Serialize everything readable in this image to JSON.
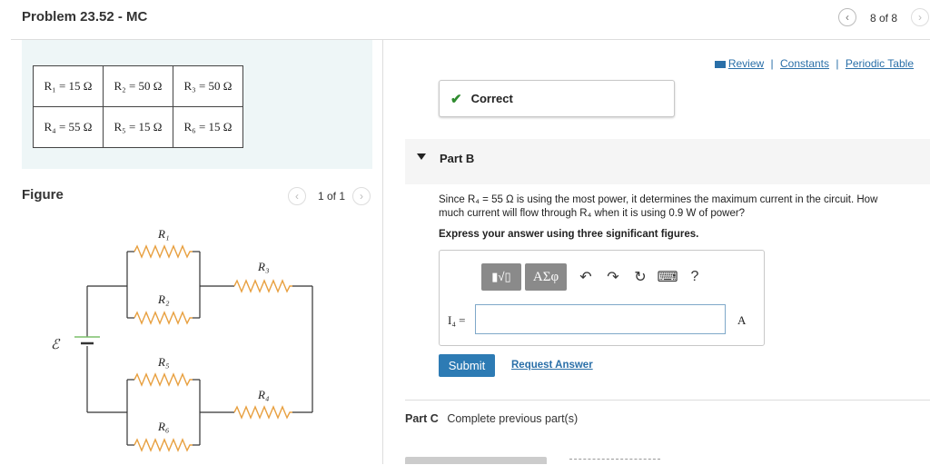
{
  "header": {
    "title": "Problem 23.52 - MC",
    "prev_icon": "chevron-left-icon",
    "pagination": "8 of 8",
    "next_icon": "chevron-right-icon"
  },
  "resistor_table": {
    "rows": [
      [
        "R₁ = 15 Ω",
        "R₂ = 50 Ω",
        "R₃ = 50 Ω"
      ],
      [
        "R₄ = 55 Ω",
        "R₅ = 15 Ω",
        "R₆ = 15 Ω"
      ]
    ]
  },
  "figure": {
    "label": "Figure",
    "pager": "1 of 1",
    "labels": {
      "r1": "R₁",
      "r2": "R₂",
      "r3": "R₃",
      "r4": "R₄",
      "r5": "R₅",
      "r6": "R₆",
      "emf": "ℰ"
    },
    "resistor_color": "#e8a040"
  },
  "top_links": {
    "review": "Review",
    "constants": "Constants",
    "periodic_table": "Periodic Table",
    "separator": "|"
  },
  "feedback": {
    "status": "Correct",
    "status_color": "#2e8b2e"
  },
  "part_b": {
    "label": "Part B",
    "question_line1": "Since R₄ = 55 Ω is using the most power, it determines the maximum current in the circuit. How",
    "question_line2": "much current will flow through R₄ when it is using 0.9 W of power?",
    "instruction": "Express your answer using three significant figures.",
    "toolbar": {
      "template_btn": "▮√▯",
      "greek_btn": "ΑΣφ",
      "undo_icon": "undo-icon",
      "redo_icon": "redo-icon",
      "reset_icon": "reset-icon",
      "keyboard_icon": "keyboard-icon",
      "help": "?"
    },
    "answer_label": "I₄ =",
    "answer_value": "",
    "unit": "A",
    "submit": "Submit",
    "request_answer": "Request Answer"
  },
  "part_c": {
    "label": "Part C",
    "text": "Complete previous part(s)"
  },
  "colors": {
    "accent": "#2d7bb4",
    "link": "#2a6fa8",
    "panel_bg": "#eef6f7"
  }
}
